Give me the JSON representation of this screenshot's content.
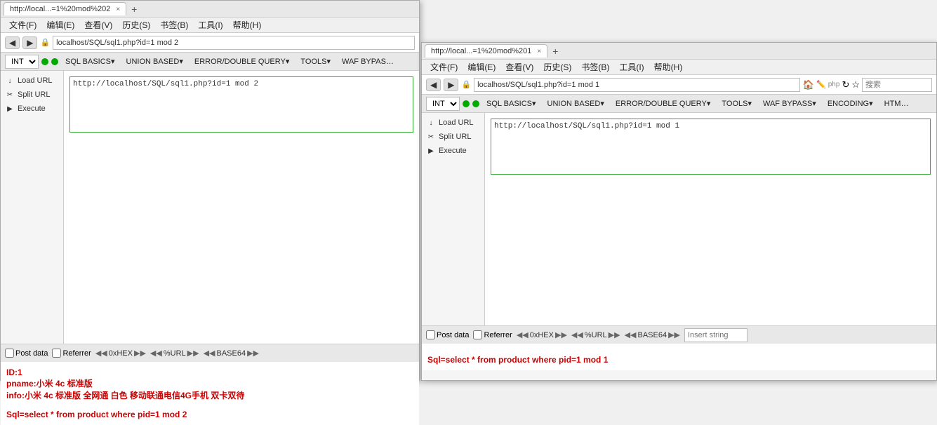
{
  "window1": {
    "tab_label": "http://local...=1%20mod%202",
    "tab_close": "×",
    "tab_new": "+",
    "menu": {
      "items": [
        "文件(F)",
        "编辑(E)",
        "查看(V)",
        "历史(S)",
        "书签(B)",
        "工具(I)",
        "帮助(H)"
      ]
    },
    "address_bar": {
      "lock": "🔒",
      "url": "localhost/SQL/sql1.php?id=1 mod 2",
      "back": "◀",
      "forward": "▶"
    },
    "toolbar": {
      "int_value": "INT",
      "items": [
        "SQL BASICS▾",
        "UNION BASED▾",
        "ERROR/DOUBLE QUERY▾",
        "TOOLS▾",
        "WAF BYPAS…"
      ]
    },
    "sidebar": {
      "items": [
        {
          "icon": "↓",
          "label": "Load URL"
        },
        {
          "icon": "✂",
          "label": "Split URL"
        },
        {
          "icon": "▶",
          "label": "Execute"
        }
      ]
    },
    "url_input": "http://localhost/SQL/sql1.php?id=1 mod 2",
    "bottom_toolbar": {
      "post_data": "Post data",
      "referrer": "Referrer",
      "hex_label": "0xHEX",
      "url_label": "%URL",
      "base64_label": "BASE64"
    },
    "result": {
      "id": "ID:1",
      "pname": "pname:小米 4c 标准版",
      "info": "info:小米 4c 标准版 全网通 白色 移动联通电信4G手机 双卡双待",
      "sql": "Sql=select * from product where pid=1 mod 2"
    }
  },
  "window2": {
    "tab_label": "http://local...=1%20mod%201",
    "tab_close": "×",
    "tab_new": "+",
    "menu": {
      "items": [
        "文件(F)",
        "编辑(E)",
        "查看(V)",
        "历史(S)",
        "书签(B)",
        "工具(I)",
        "帮助(H)"
      ]
    },
    "address_bar": {
      "lock": "🔒",
      "url": "localhost/SQL/sql1.php?id=1 mod 1",
      "back": "◀",
      "forward": "▶",
      "search_placeholder": "搜索"
    },
    "toolbar": {
      "int_value": "INT",
      "items": [
        "SQL BASICS▾",
        "UNION BASED▾",
        "ERROR/DOUBLE QUERY▾",
        "TOOLS▾",
        "WAF BYPASS▾",
        "ENCODING▾",
        "HTM…"
      ]
    },
    "sidebar": {
      "items": [
        {
          "icon": "↓",
          "label": "Load URL"
        },
        {
          "icon": "✂",
          "label": "Split URL"
        },
        {
          "icon": "▶",
          "label": "Execute"
        }
      ]
    },
    "url_input": "http://localhost/SQL/sql1.php?id=1 mod 1",
    "bottom_toolbar": {
      "post_data": "Post data",
      "referrer": "Referrer",
      "hex_label": "0xHEX",
      "url_label": "%URL",
      "base64_label": "BASE64",
      "insert_placeholder": "Insert string"
    },
    "result": {
      "sql": "Sql=select * from product where pid=1 mod 1"
    }
  }
}
